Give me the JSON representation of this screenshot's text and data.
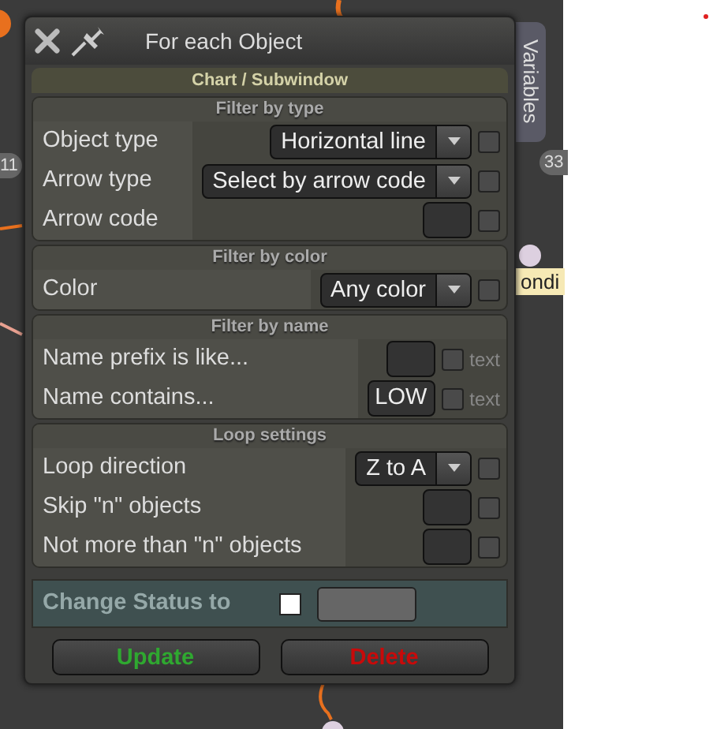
{
  "canvas_labels": [
    {
      "text": "11",
      "kind": "left"
    },
    {
      "text": "33",
      "kind": "right"
    },
    {
      "text": "ondi",
      "kind": "note"
    }
  ],
  "window": {
    "title": "For each Object"
  },
  "side_tab": "Variables",
  "subheader": "Chart / Subwindow",
  "sections": [
    {
      "title": "Filter by type",
      "rows": [
        {
          "label": "Object type",
          "kind": "select",
          "value": "Horizontal line",
          "checked": false
        },
        {
          "label": "Arrow type",
          "kind": "select",
          "value": "Select by arrow code",
          "checked": false
        },
        {
          "label": "Arrow code",
          "kind": "input",
          "checked": false
        }
      ]
    },
    {
      "title": "Filter by color",
      "rows": [
        {
          "label": "Color",
          "kind": "select",
          "value": "Any color",
          "checked": false
        }
      ]
    },
    {
      "title": "Filter by name",
      "rows": [
        {
          "label": "Name prefix is like...",
          "kind": "text-input",
          "suffix": "text",
          "checked": false
        },
        {
          "label": "Name contains...",
          "kind": "text-input",
          "value": "LOW",
          "suffix": "text",
          "checked": false
        }
      ]
    },
    {
      "title": "Loop settings",
      "rows": [
        {
          "label": "Loop direction",
          "kind": "select",
          "value": "Z to A",
          "checked": false
        },
        {
          "label": "Skip \"n\" objects",
          "kind": "input",
          "checked": false
        },
        {
          "label": "Not more than \"n\" objects",
          "kind": "input",
          "checked": false
        }
      ]
    }
  ],
  "status": {
    "label": "Change Status to",
    "checked": false
  },
  "buttons": [
    {
      "label": "Update",
      "kind": "update"
    },
    {
      "label": "Delete",
      "kind": "delete"
    }
  ]
}
